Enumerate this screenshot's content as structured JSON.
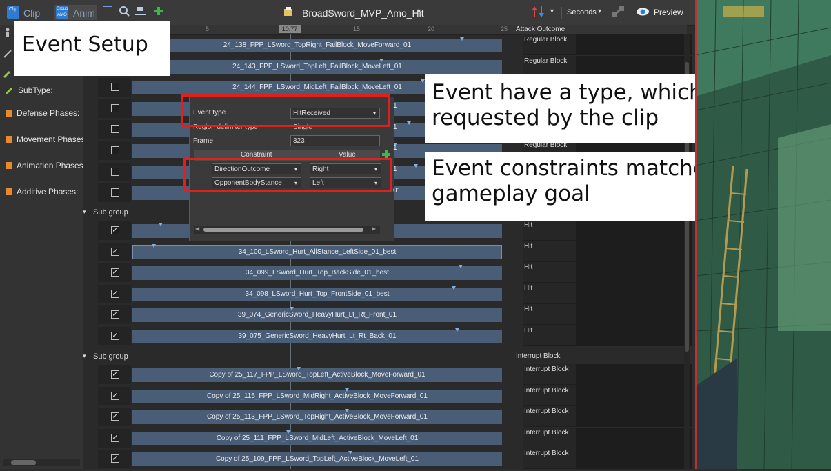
{
  "toolbar": {
    "clip_label": "Clip",
    "clip_icon_text": "Clip",
    "anim_label": "Anim",
    "group_icon_text": "Group AMO",
    "title": "BroadSword_MVP_Amo_Hit",
    "units": "Seconds",
    "preview_label": "Preview"
  },
  "callouts": {
    "event_setup": "Event Setup",
    "event_type": "Event have a type, which will get requested by the clip",
    "constraints": "Event constraints matched in gameplay goal"
  },
  "left_panel": {
    "subtype_label": "SubType:",
    "properties": [
      "Defense Phases:",
      "Movement Phases",
      "Animation Phases",
      "Additive Phases:"
    ]
  },
  "ruler": {
    "ticks": [
      "5",
      "10",
      "15",
      "20",
      "25"
    ],
    "playhead": "10.77",
    "column_header": "Attack Outcome"
  },
  "popup": {
    "event_type_label": "Event type",
    "event_type_value": "HitReceived",
    "region_label": "Region delimiter type",
    "region_value": "Single",
    "frame_label": "Frame",
    "frame_value": "323",
    "col_constraint": "Constraint",
    "col_value": "Value",
    "constraints": [
      {
        "name": "DirectionOutcome",
        "value": "Right"
      },
      {
        "name": "OpponentBodyStance",
        "value": "Left"
      }
    ]
  },
  "rows": [
    {
      "label": "24_138_FPP_LSword_TopRight_FailBlock_MoveForward_01",
      "outcome": "Regular Block",
      "checked": false
    },
    {
      "label": "24_143_FPP_LSword_TopLeft_FailBlock_MoveLeft_01",
      "outcome": "Regular Block",
      "checked": false
    },
    {
      "label": "24_144_FPP_LSword_MidLeft_FailBlock_MoveLeft_01",
      "outcome": "",
      "checked": false
    },
    {
      "label": "",
      "outcome": "",
      "checked": false
    },
    {
      "label": "",
      "outcome": "",
      "checked": false
    },
    {
      "label": "",
      "outcome": "Regular Block",
      "checked": false
    },
    {
      "label": "",
      "outcome": "",
      "checked": false
    },
    {
      "label": "",
      "outcome": "",
      "checked": false
    }
  ],
  "sub_group_label": "Sub group",
  "group2_header_outcome": "",
  "rows2": [
    {
      "label": "",
      "outcome": "Hit",
      "checked": true
    },
    {
      "label": "34_100_LSword_Hurt_AllStance_LeftSide_01_best",
      "outcome": "Hit",
      "checked": true
    },
    {
      "label": "34_099_LSword_Hurt_Top_BackSide_01_best",
      "outcome": "Hit",
      "checked": true
    },
    {
      "label": "34_098_LSword_Hurt_Top_FrontSide_01_best",
      "outcome": "Hit",
      "checked": true
    },
    {
      "label": "39_074_GenericSword_HeavyHurt_Lt_Rt_Front_01",
      "outcome": "Hit",
      "checked": true
    },
    {
      "label": "39_075_GenericSword_HeavyHurt_Lt_Rt_Back_01",
      "outcome": "Hit",
      "checked": true
    }
  ],
  "group3_header_outcome": "Interrupt Block",
  "rows3": [
    {
      "label": "Copy of 25_117_FPP_LSword_TopLeft_ActiveBlock_MoveForward_01",
      "outcome": "Interrupt Block",
      "checked": true
    },
    {
      "label": "Copy of 25_115_FPP_LSword_MidRight_ActiveBlock_MoveForward_01",
      "outcome": "Interrupt Block",
      "checked": true
    },
    {
      "label": "Copy of 25_113_FPP_LSword_TopRight_ActiveBlock_MoveForward_01",
      "outcome": "Interrupt Block",
      "checked": true
    },
    {
      "label": "Copy of 25_111_FPP_LSword_MidLeft_ActiveBlock_MoveLeft_01",
      "outcome": "Interrupt Block",
      "checked": true
    },
    {
      "label": "Copy of 25_109_FPP_LSword_TopLeft_ActiveBlock_MoveLeft_01",
      "outcome": "Interrupt Block",
      "checked": true
    }
  ],
  "partial_texts": [
    "1",
    "1",
    "1",
    "1",
    "01"
  ],
  "colors": {
    "accent": "#2e7bd1",
    "bar": "#4a5d76",
    "highlight": "#e0201c",
    "add": "#3cb84a"
  }
}
